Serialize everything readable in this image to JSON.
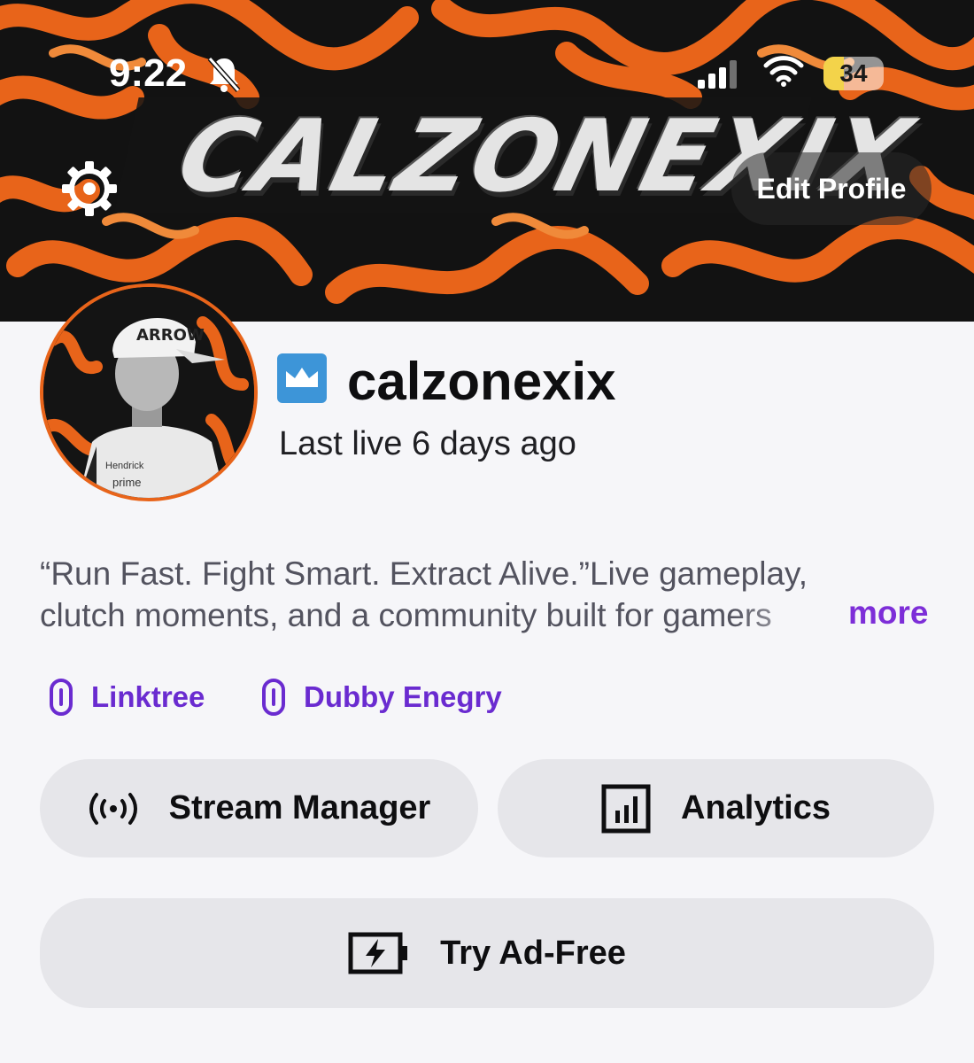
{
  "status_bar": {
    "time": "9:22",
    "battery_percent": "34",
    "battery_level": 0.34,
    "icons": [
      "bell-off-icon",
      "signal-icon",
      "wifi-icon",
      "battery-icon"
    ]
  },
  "banner": {
    "title": "CALZONEXIX",
    "colors": {
      "orange": "#e8641a",
      "dark": "#111111"
    },
    "edit_profile_label": "Edit Profile",
    "settings_icon": "gear-icon"
  },
  "profile": {
    "username": "calzonexix",
    "badge_icon": "crown-badge-icon",
    "last_live": "Last live 6 days ago",
    "bio_line1": "“Run Fast. Fight Smart. Extract Alive.”Live gameplay,",
    "bio_line2": "clutch moments, and a community built for gamers",
    "more_label": "more"
  },
  "links": [
    {
      "label": "Linktree",
      "icon": "link-icon"
    },
    {
      "label": "Dubby Enegry",
      "icon": "link-icon"
    }
  ],
  "actions": {
    "stream_manager": {
      "label": "Stream Manager",
      "icon": "broadcast-icon"
    },
    "analytics": {
      "label": "Analytics",
      "icon": "bar-chart-icon"
    },
    "ad_free": {
      "label": "Try Ad-Free",
      "icon": "battery-bolt-icon"
    }
  },
  "accent_color": "#7d2ed8"
}
